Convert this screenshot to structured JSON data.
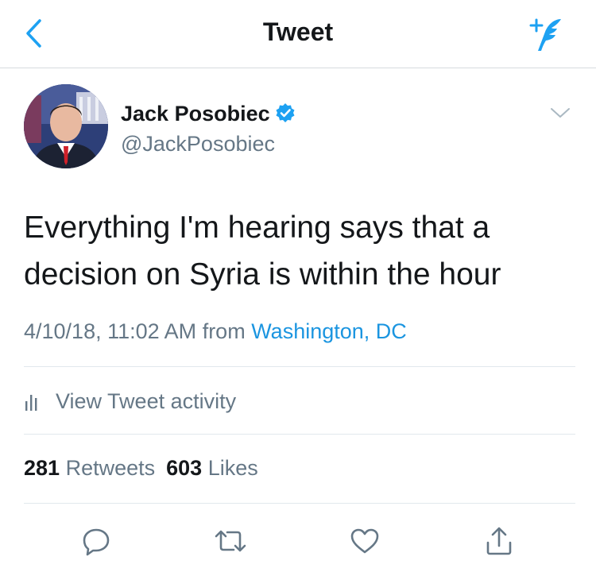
{
  "nav": {
    "title": "Tweet",
    "back_icon": "chevron-left-icon",
    "compose_icon": "compose-tweet-icon"
  },
  "tweet": {
    "author_name": "Jack Posobiec",
    "author_handle": "@JackPosobiec",
    "verified": true,
    "text": "Everything I'm hearing says that a decision on Syria is within the hour",
    "timestamp": "4/10/18, 11:02 AM",
    "from_label": "from",
    "location": "Washington, DC"
  },
  "activity": {
    "label": "View Tweet activity",
    "icon": "bar-chart-icon"
  },
  "stats": {
    "retweets_count": "281",
    "retweets_label": "Retweets",
    "likes_count": "603",
    "likes_label": "Likes"
  },
  "actions": [
    "reply-icon",
    "retweet-icon",
    "like-icon",
    "share-icon"
  ],
  "colors": {
    "accent": "#1da1f2",
    "link": "#1b95e0",
    "secondary_text": "#657786",
    "primary_text": "#14171a",
    "divider": "#e1e8ed"
  }
}
